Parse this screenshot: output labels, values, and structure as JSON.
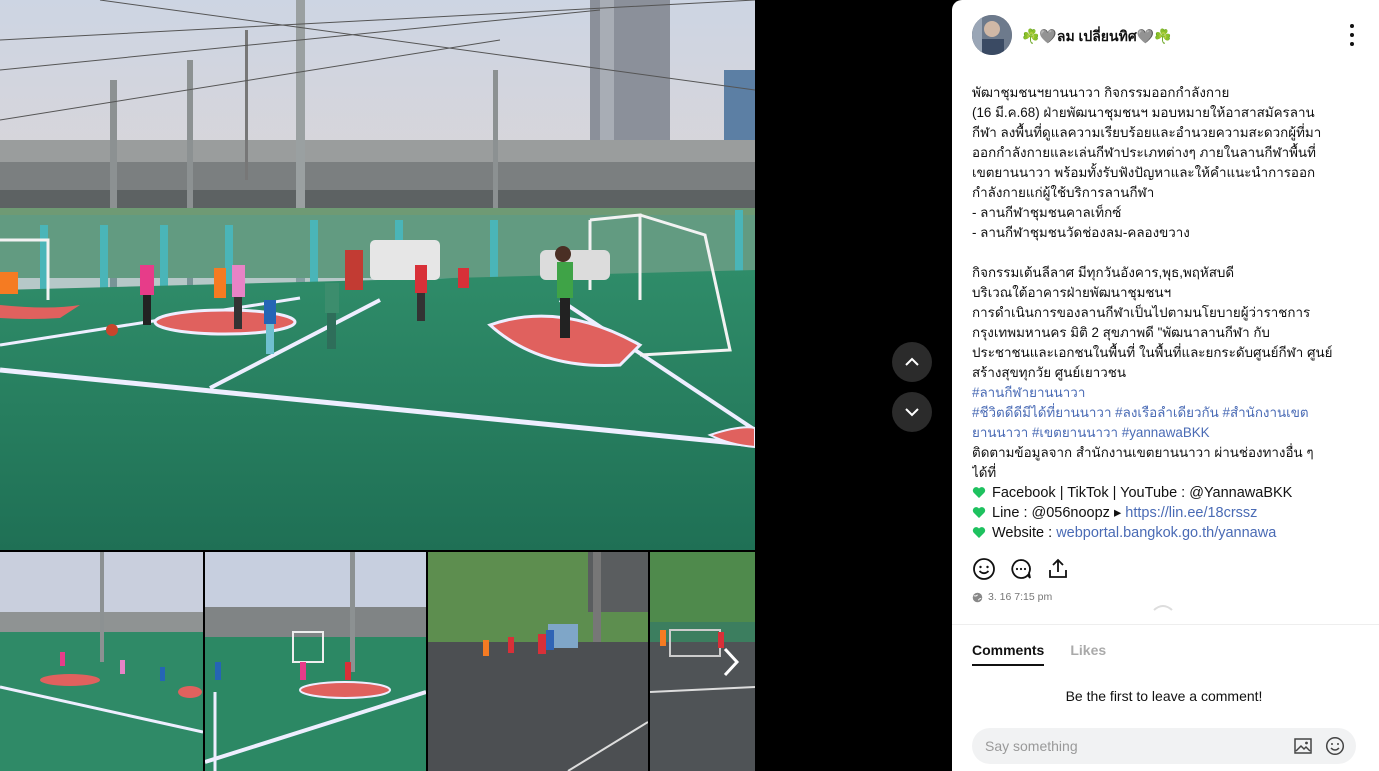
{
  "post": {
    "username": "☘️🩶ลม เปลี่ยนทิศ🩶☘️",
    "caption_lines": [
      "พัฒาชุมชนฯยานนาวา กิจกรรมออกกำลังกาย",
      " (16 มี.ค.68)  ฝ่ายพัฒนาชุมชนฯ มอบหมายให้อาสาสมัครลาน",
      "กีฬา ลงพื้นที่ดูแลความเรียบร้อยและอำนวยความสะดวกผู้ที่มา",
      "ออกกำลังกายและเล่นกีฬาประเภทต่างๆ ภายในลานกีฬาพื้นที่",
      "เขตยานนาวา พร้อมทั้งรับฟังปัญหาและให้คำแนะนำการออก",
      "กำลังกายแก่ผู้ใช้บริการลานกีฬา",
      "- ลานกีฬาชุมชนคาลเท็กซ์",
      "- ลานกีฬาชุมชนวัดช่องลม-คลองขวาง",
      "",
      "กิจกรรมเต้นลีลาศ มีทุกวันอังคาร,พุธ,พฤหัสบดี",
      "บริเวณใต้อาคารฝ่ายพัฒนาชุมชนฯ",
      "   การดำเนินการของลานกีฬาเป็นไปตามนโยบายผู้ว่าราชการ",
      "กรุงเทพมหานคร  มิติ 2 สุขภาพดี  \"พัฒนาลานกีฬา กับ",
      "ประชาชนและเอกชนในพื้นที่ ในพื้นที่และยกระดับศูนย์กีฬา ศูนย์",
      "สร้างสุขทุกวัย ศูนย์เยาวชน"
    ],
    "hashtag_lines": [
      "#ลานกีฬายานนาวา",
      "#ชีวิตดีดีมีได้ที่ยานนาวา #ลงเรือลำเดียวกัน #สำนักงานเขต",
      "ยานนาวา #เขตยานนาวา #yannawaBKK"
    ],
    "follow_lines": [
      "ติดตามข้อมูลจาก สำนักงานเขตยานนาวา ผ่านช่องทางอื่น ๆ",
      "ได้ที่"
    ],
    "socials": [
      {
        "text": "Facebook | TikTok | YouTube : @YannawaBKK",
        "link": ""
      },
      {
        "text": "Line : @056noopz ▸ ",
        "link": "https://lin.ee/18crssz"
      },
      {
        "text": "Website : ",
        "link": "webportal.bangkok.go.th/yannawa"
      }
    ],
    "timestamp": "3. 16 7:15 pm"
  },
  "tabs": {
    "comments": "Comments",
    "likes": "Likes"
  },
  "empty_comments": "Be the first to leave a comment!",
  "comment_input": {
    "placeholder": "Say something"
  },
  "colors": {
    "accent_green": "#1ec15f",
    "link_blue": "#4a6bb5",
    "court_green": "#2e8a66",
    "court_red": "#e0615e"
  },
  "icons": [
    "up-chevron-icon",
    "down-chevron-icon",
    "next-arrow-icon",
    "more-icon",
    "like-icon",
    "comment-icon",
    "share-icon",
    "globe-icon",
    "image-icon",
    "emoji-icon",
    "green-heart-icon"
  ]
}
